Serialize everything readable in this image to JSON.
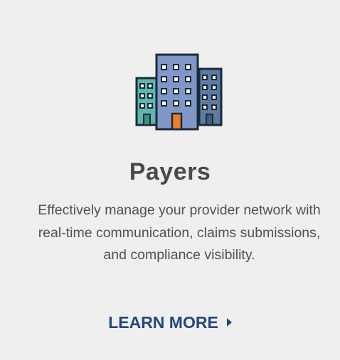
{
  "card": {
    "icon": "office-buildings-icon",
    "title": "Payers",
    "description": "Effectively manage your provider network with real-time communication, claims submissions, and compliance visibility.",
    "cta": {
      "label": "LEARN MORE",
      "icon": "caret-right-icon"
    }
  },
  "colors": {
    "background": "#efefef",
    "title": "#4a4a4a",
    "description": "#505050",
    "cta": "#27467f",
    "building_teal": "#5fb6ad",
    "building_blue_center": "#7f98c8",
    "building_blue_right": "#5e7ba2",
    "door_orange": "#f07b2b",
    "outline": "#1b2a38"
  }
}
